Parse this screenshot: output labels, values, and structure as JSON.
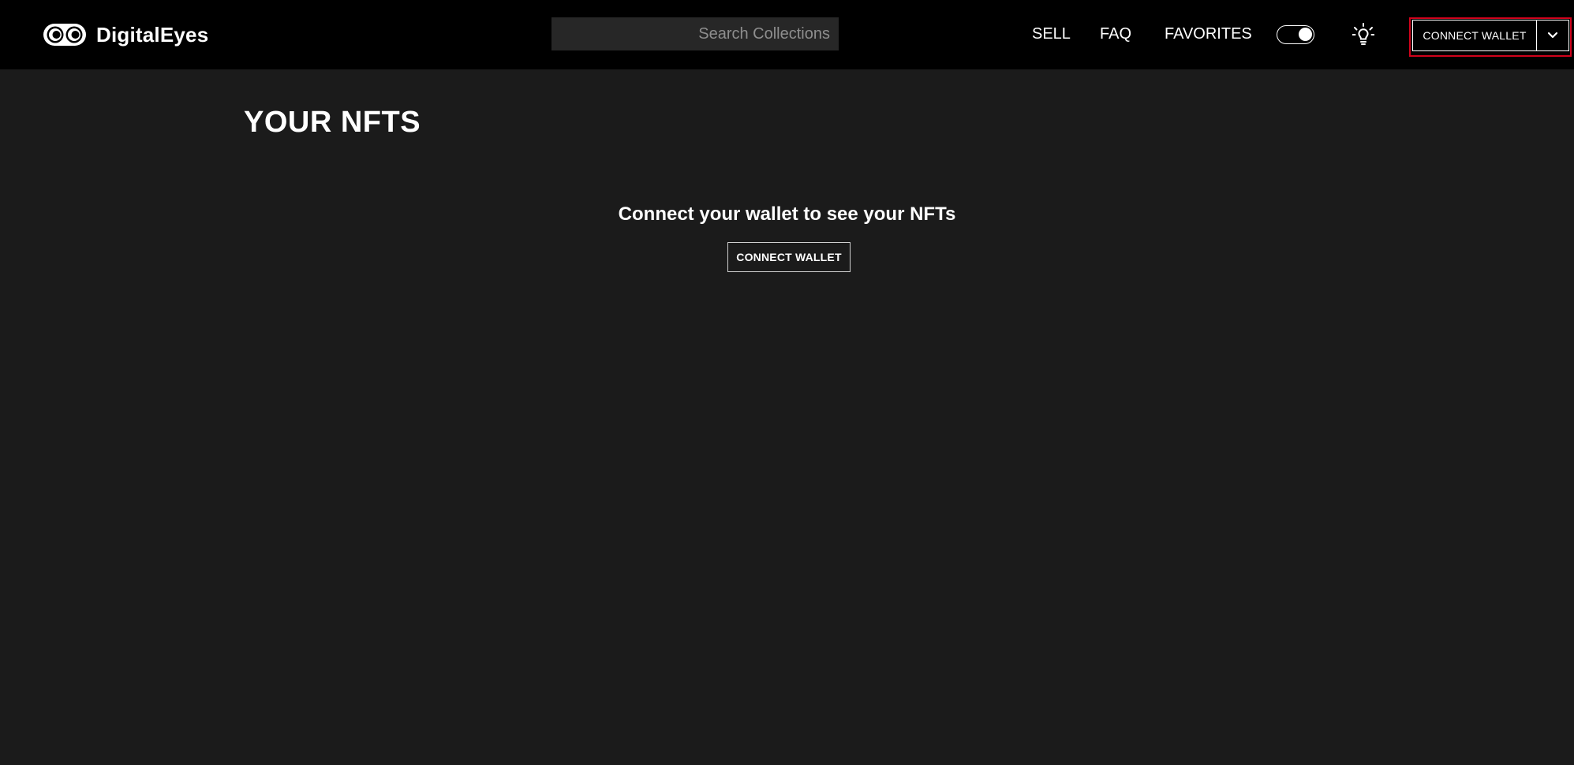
{
  "header": {
    "logo_text": "DigitalEyes",
    "logo_icon": "eyes-logo-icon",
    "search_placeholder": "Search Collections",
    "search_value": "",
    "nav": {
      "sell": "SELL",
      "faq": "FAQ",
      "favorites": "FAVORITES"
    },
    "theme_toggle_icon": "dark-mode-toggle-icon",
    "light_icon": "lightbulb-icon",
    "connect_wallet_label": "CONNECT WALLET",
    "wallet_dropdown_icon": "chevron-down-icon"
  },
  "main": {
    "title": "YOUR NFTS",
    "empty_message": "Connect your wallet to see your NFTs",
    "connect_wallet_label": "CONNECT WALLET"
  },
  "colors": {
    "header_bg": "#000000",
    "page_bg": "#1b1b1b",
    "search_bg": "#272727",
    "highlight_border": "#d0021b"
  }
}
